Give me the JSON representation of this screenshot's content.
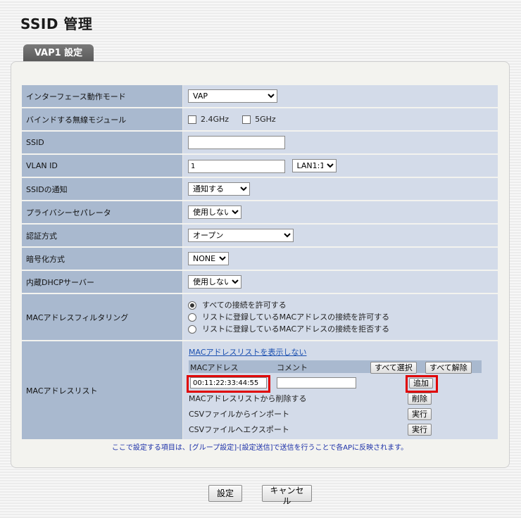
{
  "page": {
    "title": "SSID 管理",
    "tab": "VAP1 設定"
  },
  "rows": {
    "mode": {
      "label": "インターフェース動作モード",
      "value": "VAP"
    },
    "bind": {
      "label": "バインドする無線モジュール",
      "opt1": "2.4GHz",
      "opt2": "5GHz"
    },
    "ssid": {
      "label": "SSID",
      "value": ""
    },
    "vlan": {
      "label": "VLAN ID",
      "value": "1",
      "port": "LAN1:1"
    },
    "notify": {
      "label": "SSIDの通知",
      "value": "通知する"
    },
    "privacy": {
      "label": "プライバシーセパレータ",
      "value": "使用しない"
    },
    "auth": {
      "label": "認証方式",
      "value": "オープン"
    },
    "cipher": {
      "label": "暗号化方式",
      "value": "NONE"
    },
    "dhcp": {
      "label": "内蔵DHCPサーバー",
      "value": "使用しない"
    },
    "macfilter": {
      "label": "MACアドレスフィルタリング",
      "options": [
        "すべての接続を許可する",
        "リストに登録しているMACアドレスの接続を許可する",
        "リストに登録しているMACアドレスの接続を拒否する"
      ]
    },
    "maclist": {
      "label": "MACアドレスリスト",
      "toggle_link": "MACアドレスリストを表示しない",
      "col_mac": "MACアドレス",
      "col_comment": "コメント",
      "select_all": "すべて選択",
      "deselect_all": "すべて解除",
      "mac_value": "00:11:22:33:44:55",
      "comment_value": "",
      "add": "追加",
      "delete_label": "MACアドレスリストから削除する",
      "delete": "削除",
      "import_label": "CSVファイルからインポート",
      "import": "実行",
      "export_label": "CSVファイルへエクスポート",
      "export": "実行"
    }
  },
  "note": "ここで設定する項目は、[グループ設定]-[設定送信]で送信を行うことで各APに反映されます。",
  "footer": {
    "submit": "設定",
    "cancel": "キャンセル"
  }
}
